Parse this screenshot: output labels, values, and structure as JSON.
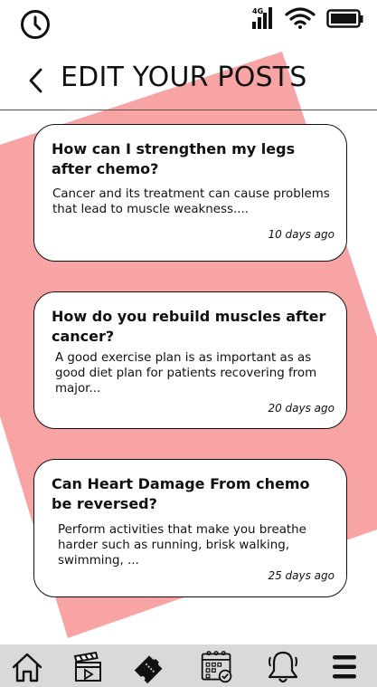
{
  "status_bar": {
    "network": "4G",
    "icons": [
      "clock-icon",
      "signal-icon",
      "wifi-icon",
      "battery-icon"
    ]
  },
  "header": {
    "title": "EDIT YOUR POSTS",
    "back_icon": "chevron-left-icon"
  },
  "accent_color": "#f8a4a4",
  "posts": [
    {
      "title": "How can I strengthen my legs after chemo?",
      "excerpt": "Cancer and its treatment can cause problems that lead to muscle weakness....",
      "time": "10 days ago"
    },
    {
      "title": "How do you rebuild muscles after cancer?",
      "excerpt": "A good exercise plan is as important as as good diet plan for patients recovering from major...",
      "time": "20 days ago"
    },
    {
      "title": "Can Heart Damage From chemo be reversed?",
      "excerpt": "Perform activities that make you breathe harder such as running, brisk walking, swimming, ...",
      "time": "25 days ago"
    }
  ],
  "bottom_nav": {
    "items": [
      "home-icon",
      "video-icon",
      "ticket-icon",
      "calendar-icon",
      "bell-icon",
      "menu-icon"
    ],
    "active": "ticket-icon"
  }
}
